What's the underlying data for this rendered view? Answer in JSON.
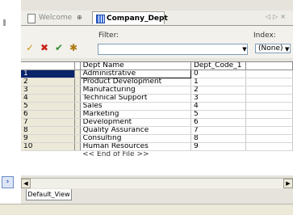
{
  "tabs": {
    "welcome": "Welcome",
    "active": "Company_Dept"
  },
  "toolbar": {
    "filter_label": "Filter:",
    "filter_value": "",
    "index_label": "Index:",
    "index_value": "(None)"
  },
  "grid": {
    "columns": [
      "Dept Name",
      "Dept_Code_1"
    ],
    "rows": [
      {
        "num": "1",
        "name": "Administrative",
        "code": "0"
      },
      {
        "num": "2",
        "name": "Product Development",
        "code": "1"
      },
      {
        "num": "3",
        "name": "Manufacturing",
        "code": "2"
      },
      {
        "num": "4",
        "name": "Technical Support",
        "code": "3"
      },
      {
        "num": "5",
        "name": "Sales",
        "code": "4"
      },
      {
        "num": "6",
        "name": "Marketing",
        "code": "5"
      },
      {
        "num": "7",
        "name": "Development",
        "code": "6"
      },
      {
        "num": "8",
        "name": "Quality Assurance",
        "code": "7"
      },
      {
        "num": "9",
        "name": "Consulting",
        "code": "8"
      },
      {
        "num": "10",
        "name": "Human Resources",
        "code": "9"
      }
    ],
    "selected_row": "1",
    "eof_text": "<< End of File >>"
  },
  "view_tab": "Default_View",
  "icons": [
    "approve-icon",
    "delete-icon",
    "check-icon",
    "filter-wand-icon",
    "page-icon",
    "grid-icon",
    "pin-icon"
  ]
}
